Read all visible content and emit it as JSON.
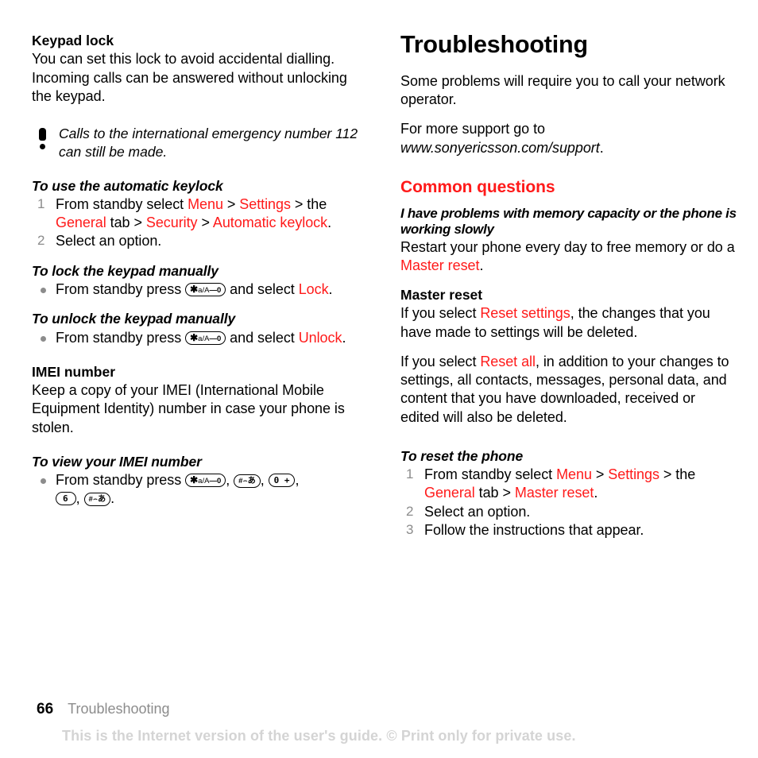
{
  "document": {
    "page_number": "66",
    "footer_chapter": "Troubleshooting",
    "footer_watermark": "This is the Internet version of the user's guide. © Print only for private use.",
    "accent_red": "#ff1a1a",
    "muted_gray": "#8c8c8c",
    "watermark_gray": "#d4d4d4"
  },
  "left_column": {
    "keypad_lock": {
      "heading": "Keypad lock",
      "body": "You can set this lock to avoid accidental dialling. Incoming calls can be answered without unlocking the keypad."
    },
    "note": {
      "icon": "exclamation-icon",
      "text": "Calls to the international emergency number 112 can still be made."
    },
    "auto_keylock": {
      "heading": "To use the automatic keylock",
      "steps": [
        {
          "num": "1",
          "parts": [
            {
              "text": "From standby select ",
              "style": "plain"
            },
            {
              "text": "Menu",
              "style": "red"
            },
            {
              "text": " > ",
              "style": "plain"
            },
            {
              "text": "Settings",
              "style": "red"
            },
            {
              "text": " > the ",
              "style": "plain"
            },
            {
              "text": "General",
              "style": "red"
            },
            {
              "text": " tab > ",
              "style": "plain"
            },
            {
              "text": "Security",
              "style": "red"
            },
            {
              "text": " > ",
              "style": "plain"
            },
            {
              "text": "Automatic keylock",
              "style": "red"
            },
            {
              "text": ".",
              "style": "plain"
            }
          ]
        },
        {
          "num": "2",
          "parts": [
            {
              "text": "Select an option.",
              "style": "plain"
            }
          ]
        }
      ]
    },
    "lock_manually": {
      "heading": "To lock the keypad manually",
      "bullet": {
        "before": "From standby press ",
        "key": "*a/A",
        "middle": " and select ",
        "target": "Lock",
        "after": "."
      }
    },
    "unlock_manually": {
      "heading": "To unlock the keypad manually",
      "bullet": {
        "before": "From standby press ",
        "key": "*a/A",
        "middle": " and select ",
        "target": "Unlock",
        "after": "."
      }
    },
    "imei": {
      "heading": "IMEI number",
      "body": "Keep a copy of your IMEI (International Mobile Equipment Identity) number in case your phone is stolen."
    },
    "view_imei": {
      "heading": "To view your IMEI number",
      "bullet_before": "From standby press ",
      "keys": [
        "*a/A",
        "#",
        "0 +",
        "6",
        "#"
      ],
      "bullet_after": "."
    }
  },
  "right_column": {
    "title": "Troubleshooting",
    "intro_1": "Some problems will require you to call your network operator.",
    "intro_2_before": "For more support go to ",
    "intro_2_url": "www.sonyericsson.com/support",
    "intro_2_after": ".",
    "common_questions_heading": "Common questions",
    "memory_question": {
      "question": "I have problems with memory capacity or the phone is working slowly",
      "answer_before": "Restart your phone every day to free memory or do a ",
      "answer_link": "Master reset",
      "answer_after": "."
    },
    "master_reset": {
      "heading": "Master reset",
      "para1_before": "If you select ",
      "para1_link": "Reset settings",
      "para1_after": ", the changes that you have made to settings will be deleted.",
      "para2_before": "If you select ",
      "para2_link": "Reset all",
      "para2_after": ", in addition to your changes to settings, all contacts, messages, personal data, and content that you have downloaded, received or edited will also be deleted."
    },
    "reset_phone": {
      "heading": "To reset the phone",
      "steps": [
        {
          "num": "1",
          "parts": [
            {
              "text": "From standby select ",
              "style": "plain"
            },
            {
              "text": "Menu",
              "style": "red"
            },
            {
              "text": " > ",
              "style": "plain"
            },
            {
              "text": "Settings",
              "style": "red"
            },
            {
              "text": " > the ",
              "style": "plain"
            },
            {
              "text": "General",
              "style": "red"
            },
            {
              "text": " tab > ",
              "style": "plain"
            },
            {
              "text": "Master reset",
              "style": "red"
            },
            {
              "text": ".",
              "style": "plain"
            }
          ]
        },
        {
          "num": "2",
          "parts": [
            {
              "text": "Select an option.",
              "style": "plain"
            }
          ]
        },
        {
          "num": "3",
          "parts": [
            {
              "text": "Follow the instructions that appear.",
              "style": "plain"
            }
          ]
        }
      ]
    }
  }
}
